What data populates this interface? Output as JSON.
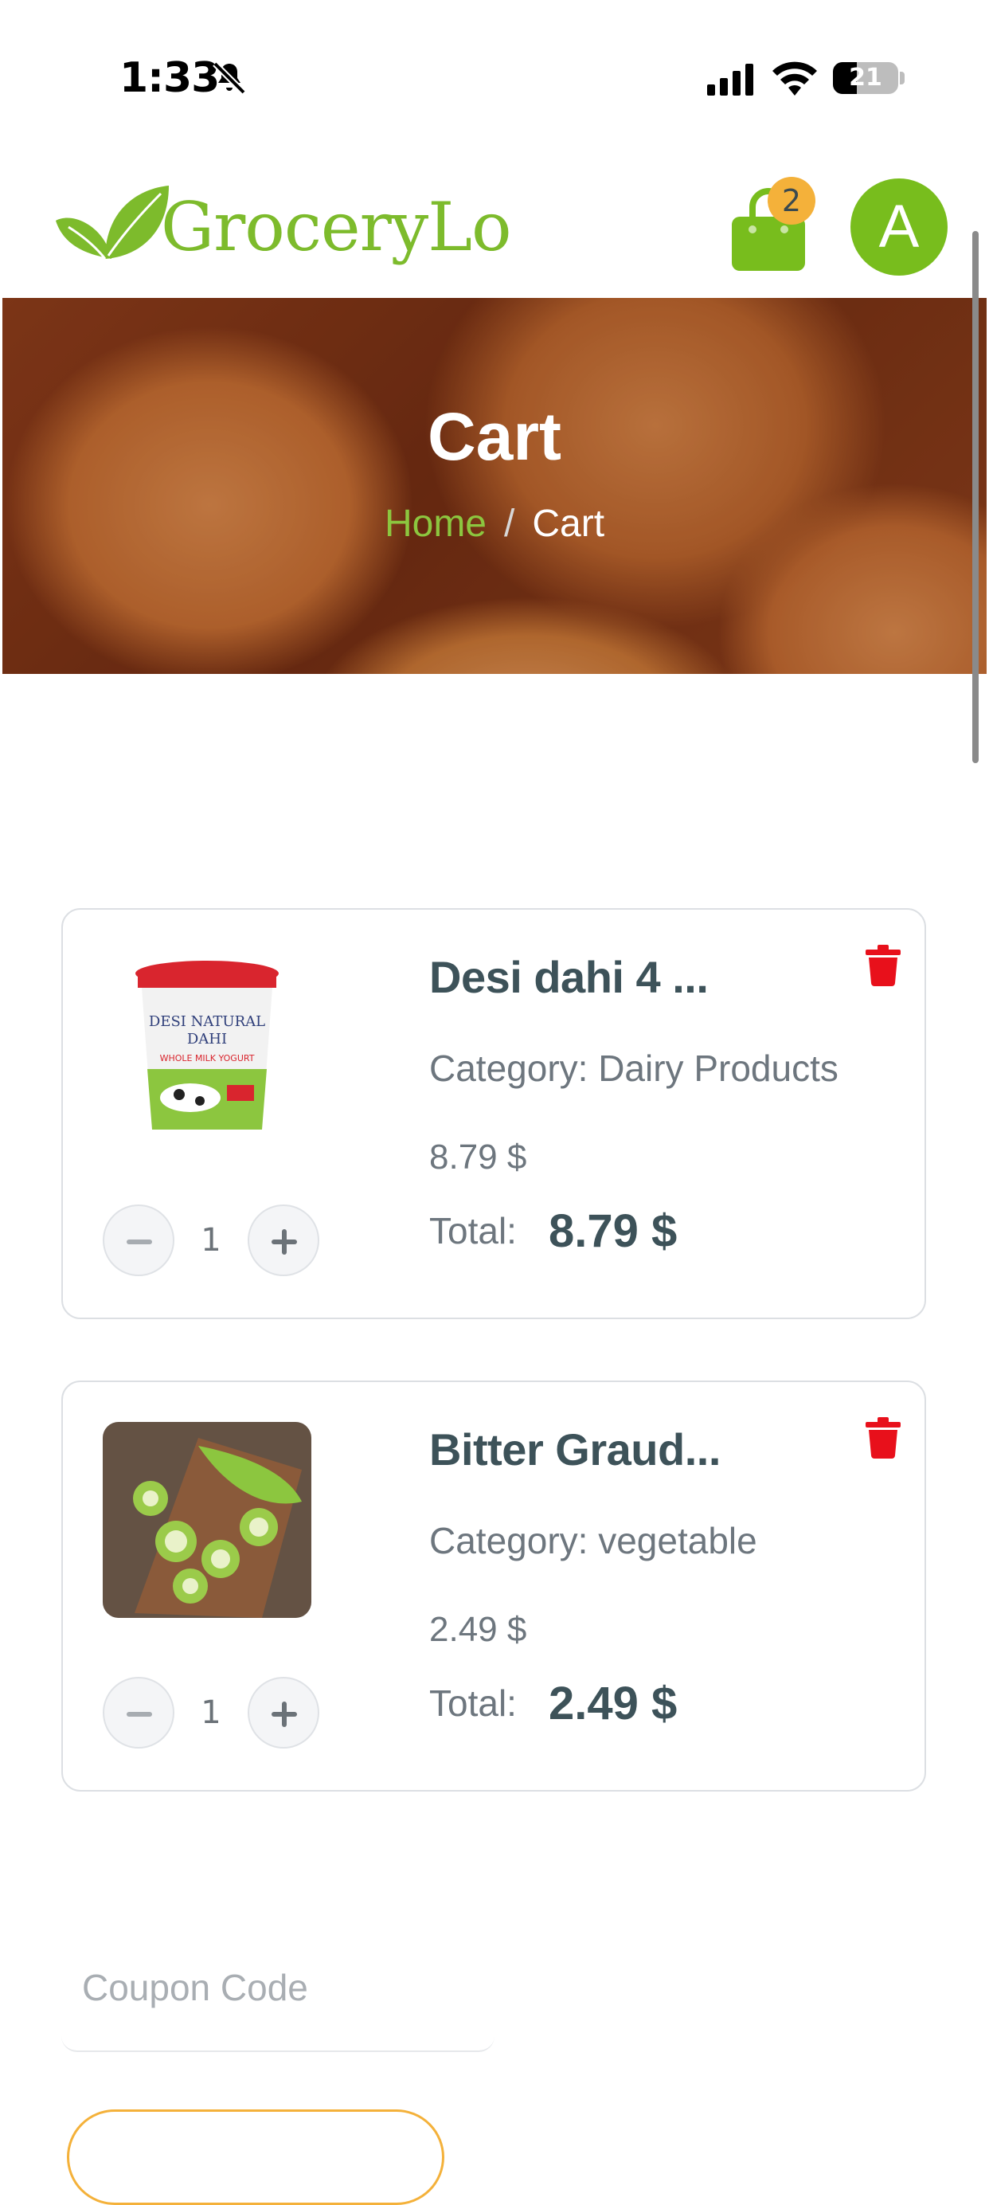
{
  "status_bar": {
    "time": "1:33",
    "battery": "21"
  },
  "header": {
    "logo_text": "GroceryLo",
    "cart_count": "2",
    "avatar_initial": "A",
    "brand_color": "#7dbb2c",
    "accent_color": "#f4b13a"
  },
  "hero": {
    "title": "Cart",
    "breadcrumb": {
      "home": "Home",
      "separator": "/",
      "current": "Cart"
    }
  },
  "cart": {
    "items": [
      {
        "name": "Desi dahi 4 ...",
        "category": "Category: Dairy Products",
        "price": "8.79 $",
        "total_label": "Total:",
        "total": "8.79 $",
        "quantity": "1",
        "image_icon": "yogurt-tub-icon"
      },
      {
        "name": "Bitter Graud...",
        "category": "Category: vegetable",
        "price": "2.49 $",
        "total_label": "Total:",
        "total": "2.49 $",
        "quantity": "1",
        "image_icon": "bitter-gourd-icon"
      }
    ]
  },
  "coupon": {
    "placeholder": "Coupon Code",
    "value": ""
  }
}
